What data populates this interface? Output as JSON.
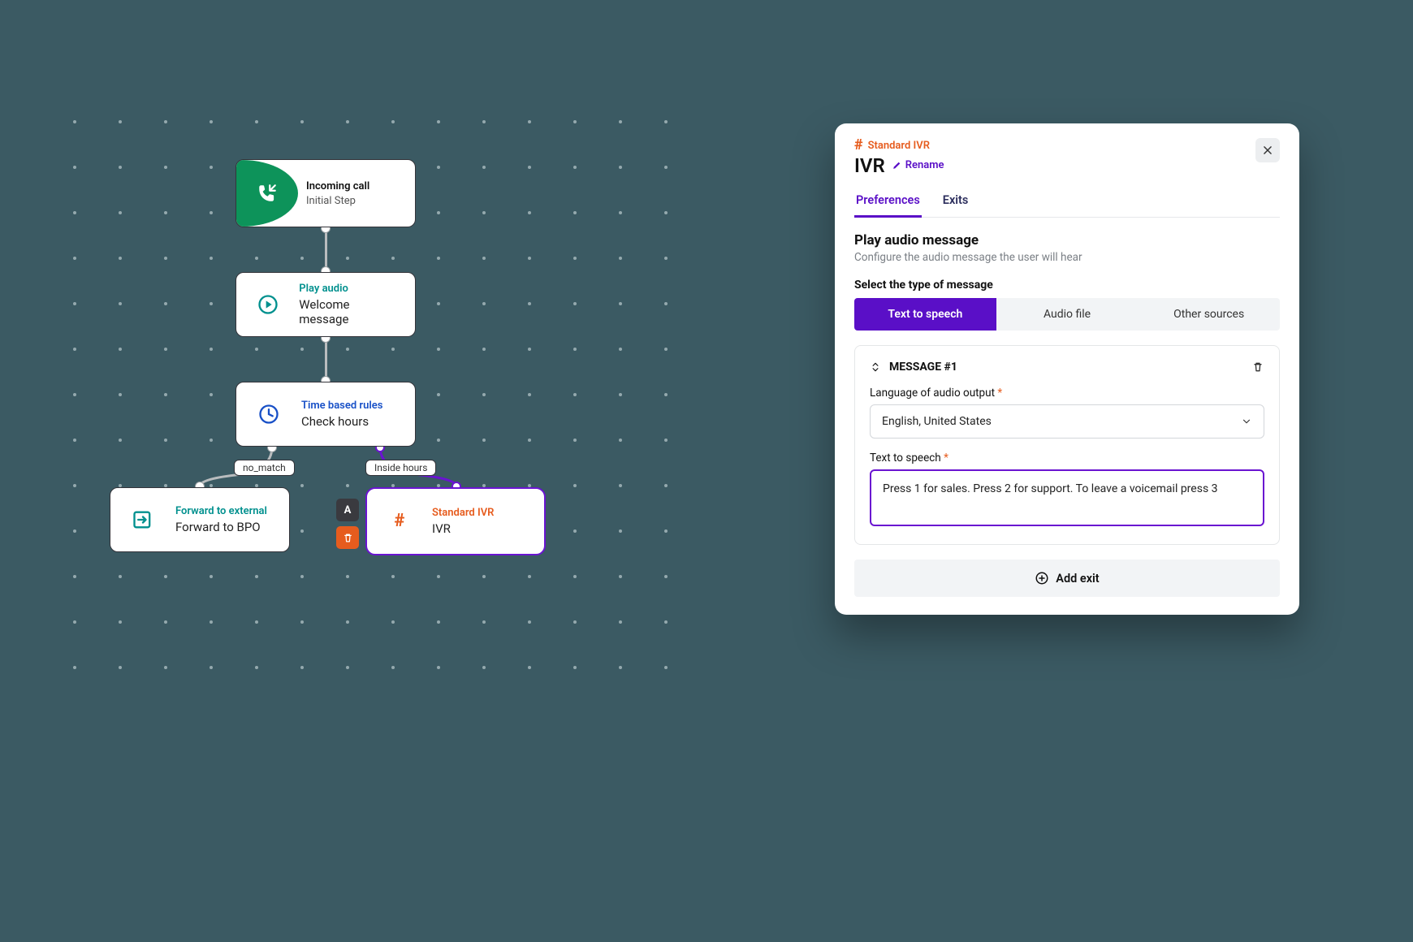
{
  "flow": {
    "incoming": {
      "category": "Incoming call",
      "title": "Initial Step"
    },
    "play": {
      "category": "Play audio",
      "title": "Welcome message"
    },
    "time": {
      "category": "Time based rules",
      "title": "Check hours"
    },
    "fwd": {
      "category": "Forward to external",
      "title": "Forward to BPO"
    },
    "ivr": {
      "category": "Standard IVR",
      "title": "IVR"
    },
    "edge_nomatch": "no_match",
    "edge_inside": "Inside hours",
    "minibtn_a": "A"
  },
  "panel": {
    "type": "Standard IVR",
    "title": "IVR",
    "rename": "Rename",
    "tabs": {
      "preferences": "Preferences",
      "exits": "Exits"
    },
    "section": {
      "title": "Play audio message",
      "sub": "Configure the audio message the user will hear"
    },
    "msgtype_label": "Select the type of message",
    "seg": {
      "tts": "Text to speech",
      "audio": "Audio file",
      "other": "Other sources"
    },
    "card": {
      "head": "MESSAGE #1"
    },
    "lang": {
      "label": "Language of audio output",
      "value": "English, United States"
    },
    "tts": {
      "label": "Text to speech",
      "value": "Press 1 for sales. Press 2 for support. To leave a voicemail press 3"
    },
    "addexit": "Add exit"
  }
}
